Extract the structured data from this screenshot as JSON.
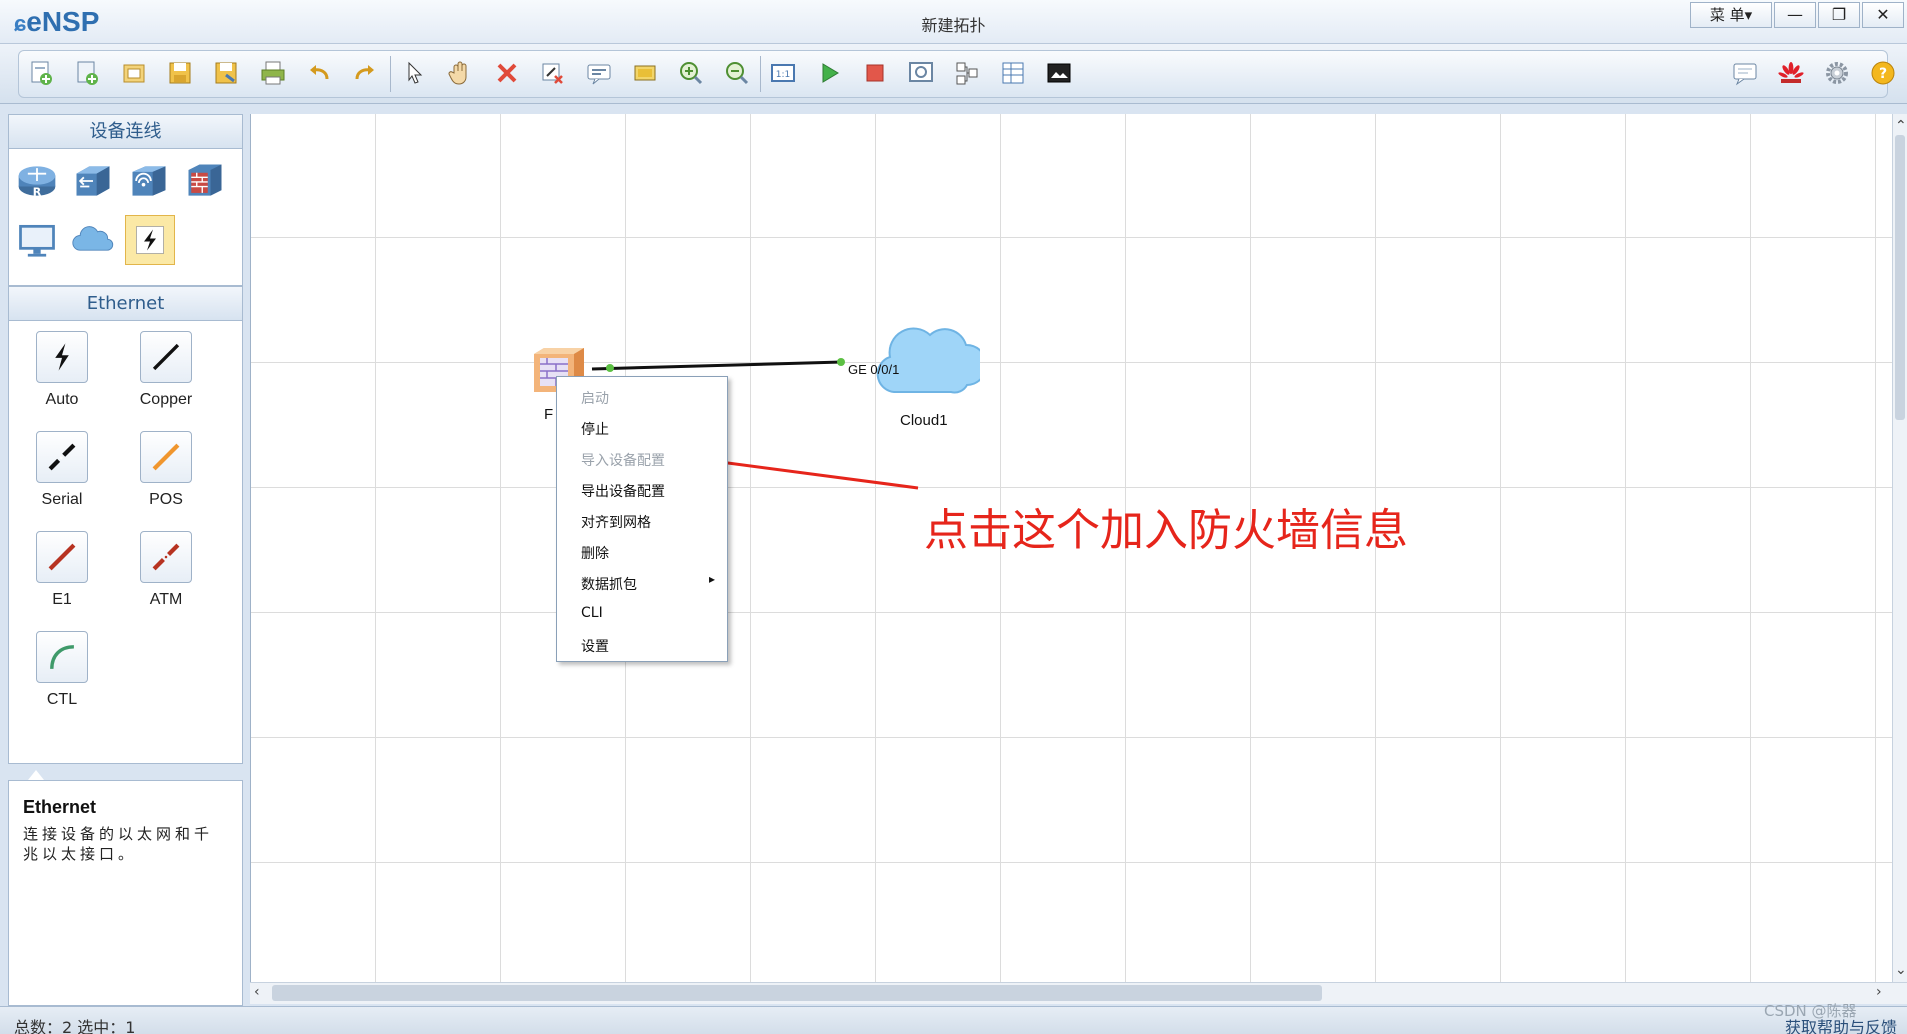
{
  "app": {
    "logo": "eNSP",
    "window_title": "新建拓扑"
  },
  "window_controls": {
    "menu_label": "菜 单▾",
    "minimize": "—",
    "restore": "❐",
    "close": "✕"
  },
  "left_panel": {
    "devices_header": "设备连线",
    "cables_header": "Ethernet",
    "cables": [
      {
        "label": "Auto"
      },
      {
        "label": "Copper"
      },
      {
        "label": "Serial"
      },
      {
        "label": "POS"
      },
      {
        "label": "E1"
      },
      {
        "label": "ATM"
      },
      {
        "label": "CTL"
      }
    ],
    "description": {
      "title": "Ethernet",
      "text": "连接设备的以太网和千兆以太接口。"
    }
  },
  "canvas": {
    "firewall_label": "F",
    "cloud_label": "Cloud1",
    "cloud_port": "GE 0/0/1",
    "link_color": "#000000"
  },
  "context_menu": {
    "items": [
      {
        "label": "启动",
        "enabled": false
      },
      {
        "label": "停止",
        "enabled": true
      },
      {
        "label": "导入设备配置",
        "enabled": false
      },
      {
        "label": "导出设备配置",
        "enabled": true
      },
      {
        "label": "对齐到网格",
        "enabled": true
      },
      {
        "label": "删除",
        "enabled": true
      },
      {
        "label": "数据抓包",
        "enabled": true,
        "submenu": true
      },
      {
        "label": "CLI",
        "enabled": true
      },
      {
        "label": "设置",
        "enabled": true
      }
    ],
    "submenu_arrow": "▸"
  },
  "annotation": {
    "text": "点击这个加入防火墙信息",
    "color": "#e6251b"
  },
  "statusbar": {
    "text": "总数：2 选中：1",
    "help": "获取帮助与反馈"
  },
  "watermark": "CSDN @陈器"
}
